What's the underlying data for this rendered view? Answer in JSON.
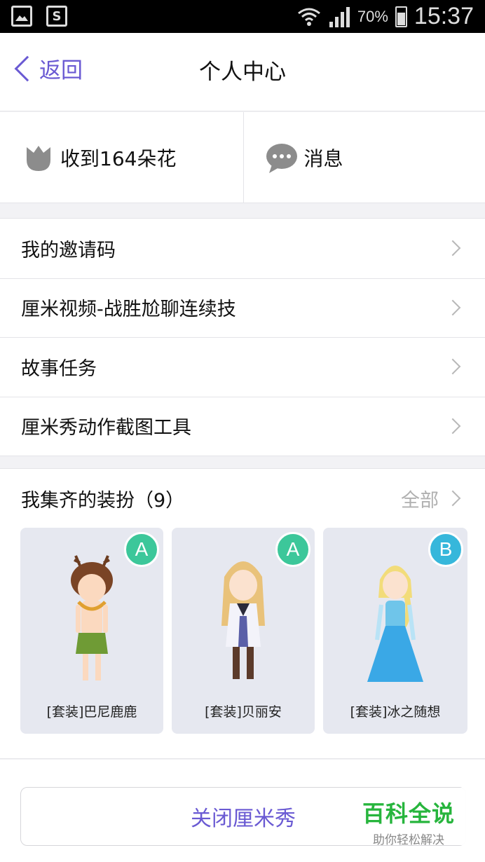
{
  "status_bar": {
    "battery": "70%",
    "time": "15:37"
  },
  "nav": {
    "back_label": "返回",
    "title": "个人中心"
  },
  "stats": {
    "flowers_label": "收到164朵花",
    "messages_label": "消息"
  },
  "menu": [
    {
      "label": "我的邀请码"
    },
    {
      "label": "厘米视频-战胜尬聊连续技"
    },
    {
      "label": "故事任务"
    },
    {
      "label": "厘米秀动作截图工具"
    }
  ],
  "outfits": {
    "title": "我集齐的装扮（9）",
    "all_label": "全部",
    "items": [
      {
        "badge": "A",
        "name": "[套装]巴尼鹿鹿"
      },
      {
        "badge": "A",
        "name": "[套装]贝丽安"
      },
      {
        "badge": "B",
        "name": "[套装]冰之随想"
      }
    ]
  },
  "close_button": {
    "label": "关闭厘米秀"
  },
  "watermark": {
    "title": "百科全说",
    "subtitle": "助你轻松解决"
  },
  "colors": {
    "accent": "#6a5ad3",
    "badge_a": "#3cc79a",
    "badge_b": "#36b7db"
  }
}
